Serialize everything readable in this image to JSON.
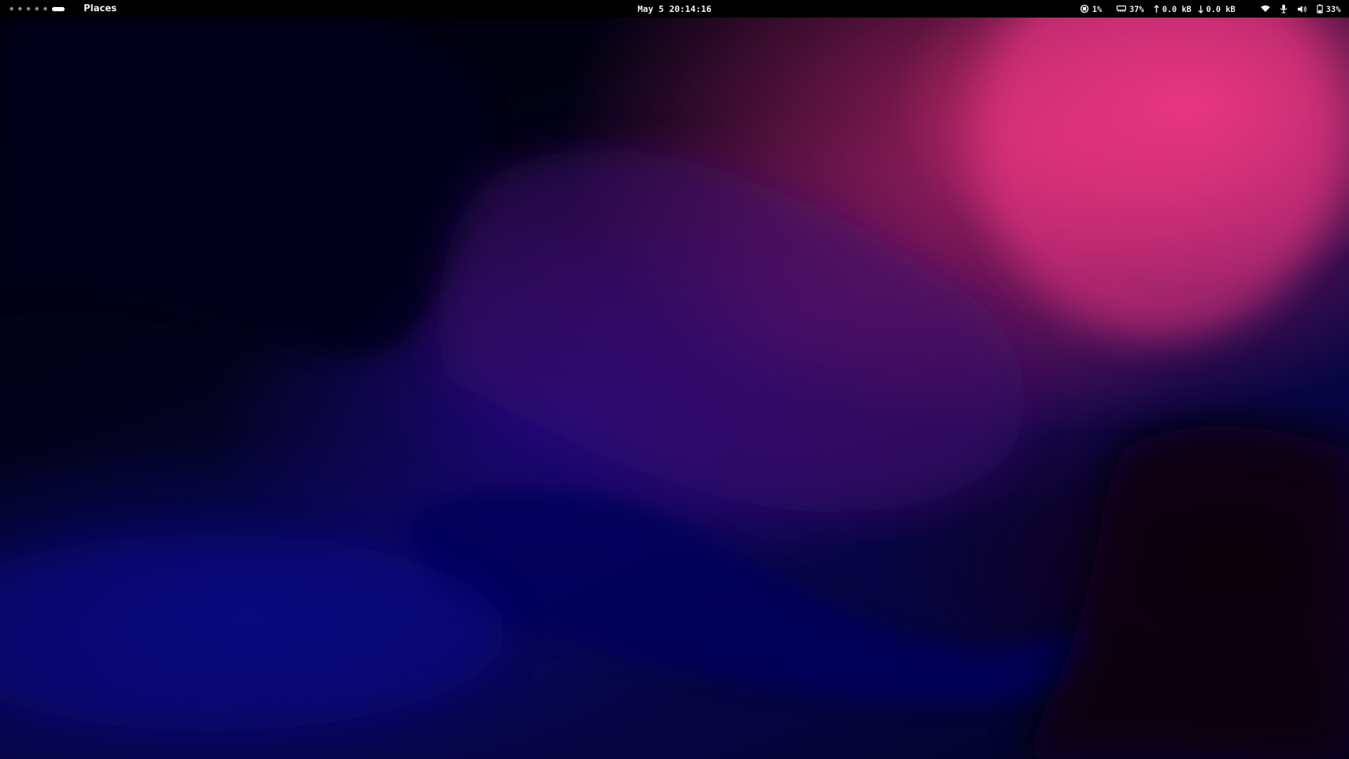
{
  "topbar": {
    "workspaces": {
      "count": 6,
      "active_index": 5
    },
    "places_label": "Places",
    "clock": "May 5 20:14:16",
    "tray": {
      "cpu": {
        "icon": "cpu-icon",
        "value": "1%"
      },
      "memory": {
        "icon": "memory-icon",
        "value": "37%"
      },
      "upload": {
        "icon": "arrow-up-icon",
        "value": "0.0 kB"
      },
      "download": {
        "icon": "arrow-down-icon",
        "value": "0.0 kB"
      },
      "wifi": {
        "icon": "wifi-icon"
      },
      "microphone": {
        "icon": "microphone-icon"
      },
      "volume": {
        "icon": "volume-icon"
      },
      "battery": {
        "icon": "battery-icon",
        "value": "33%"
      }
    }
  },
  "colors": {
    "bar_background": "#000000",
    "bar_text": "#f0f0f0",
    "wallpaper_pink": "#ec3a82",
    "wallpaper_blue": "#1c087d",
    "wallpaper_dark": "#000006"
  }
}
